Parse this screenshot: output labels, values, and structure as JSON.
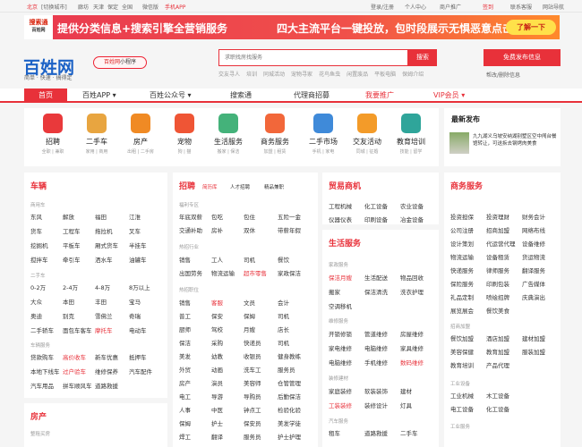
{
  "topbar": {
    "city": "北京",
    "switch": "[切换城市]",
    "links": [
      "廊坊",
      "天津",
      "保定",
      "全国",
      "微信版",
      "手机APP"
    ],
    "right": [
      "登录/注册",
      "个人中心",
      "商户推广",
      "签到",
      "联系客服",
      "网站导航"
    ]
  },
  "banner": {
    "logo_top": "搜索通",
    "logo_bottom": "百姓网",
    "text1": "提供分类信息+搜索引擎全营销服务",
    "text2": "四大主流平台一键投放，包时段展示无惧恶意点击",
    "button": "了解一下"
  },
  "brand": {
    "logo": "百姓网",
    "slogan": "简单 · 快速 · 搞得定",
    "mini_prefix": "百姓网",
    "mini_suffix": "小程序"
  },
  "search": {
    "placeholder": "求职找房找服务",
    "button": "搜索",
    "hot": [
      "交友寻人",
      "培训",
      "同城活动",
      "宠物寻家",
      "花鸟鱼虫",
      "闲置废品",
      "平板电脑",
      "保姆介绍"
    ]
  },
  "publish": {
    "button": "免费发布信息",
    "sub": "帮改/删除信息"
  },
  "nav": [
    "首页",
    "百姓APP ▾",
    "百姓公众号 ▾",
    "搜索通",
    "代理商招募",
    "我要推广",
    "VIP会员 ▾"
  ],
  "categories": [
    {
      "name": "招聘",
      "sub": "全职 | 兼职",
      "color": "#e9393b"
    },
    {
      "name": "二手车",
      "sub": "家用 | 商用",
      "color": "#e8a540"
    },
    {
      "name": "房产",
      "sub": "出租 | 二手房",
      "color": "#f08a24"
    },
    {
      "name": "宠物",
      "sub": "狗 | 猫",
      "color": "#ef5535"
    },
    {
      "name": "生活服务",
      "sub": "搬家 | 保洁",
      "color": "#44b27a"
    },
    {
      "name": "商务服务",
      "sub": "加盟 | 租赁",
      "color": "#f2673a"
    },
    {
      "name": "二手市场",
      "sub": "手机 | 家电",
      "color": "#3f8ad9"
    },
    {
      "name": "交友活动",
      "sub": "同城 | 征婚",
      "color": "#f39b29"
    },
    {
      "name": "教育培训",
      "sub": "技能 | 留学",
      "color": "#2fa59a"
    }
  ],
  "news": {
    "title": "最新发布",
    "item": "九九湖义乌坡安纳湖别墅区空中闯台餐馆转让，可送拆去钢烤肉美食"
  },
  "car": {
    "title": "车辆",
    "sub1": "商用车",
    "rows1": [
      [
        "东风",
        "解放",
        "福田",
        "江淮"
      ],
      [
        "货车",
        "工程车",
        "拖拉机",
        "叉车"
      ],
      [
        "挖掘机",
        "平板车",
        "厢式货车",
        "半挂车"
      ],
      [
        "搅拌车",
        "牵引车",
        "洒水车",
        "油罐车"
      ]
    ],
    "sub2": "二手车",
    "rows2": [
      [
        "0-2万",
        "2-4万",
        "4-8万",
        "8万以上"
      ],
      [
        "大众",
        "本田",
        "丰田",
        "宝马"
      ],
      [
        "奥迪",
        "别克",
        "雪佛兰",
        "奇瑞"
      ],
      [
        "二手轿车",
        "面包车客车",
        "摩托车",
        "电动车"
      ]
    ],
    "sub3": "车辆服务",
    "rows3": [
      [
        "贷款购车",
        "高价收车",
        "新车优惠",
        "抵押车"
      ],
      [
        "本地下线车",
        "过户验车",
        "维修保养",
        "汽车配件"
      ],
      [
        "汽车用品",
        "拼车顺风车",
        "道路救援",
        ""
      ]
    ]
  },
  "house": {
    "title": "房产",
    "sub": "整租买房"
  },
  "job": {
    "title": "招聘",
    "tabs": [
      "简历库",
      "人才招聘",
      "精品兼职"
    ],
    "sub1": "福利专区",
    "rows1": [
      [
        "年底双薪",
        "包吃",
        "包住",
        "五险一金"
      ],
      [
        "交通补助",
        "房补",
        "双休",
        "带薪年假"
      ]
    ],
    "sub2": "热招行业",
    "rows2": [
      [
        "销售",
        "工人",
        "司机",
        "餐饮"
      ],
      [
        "出国劳务",
        "物流运输",
        "超市零售",
        "家政保洁"
      ]
    ],
    "sub3": "热招职位",
    "rows3": [
      [
        "销售",
        "客服",
        "文员",
        "会计"
      ],
      [
        "普工",
        "保安",
        "保姆",
        "司机"
      ],
      [
        "厨师",
        "驾校",
        "月嫂",
        "店长"
      ],
      [
        "保洁",
        "采购",
        "快递员",
        "司机"
      ],
      [
        "美发",
        "幼教",
        "收银员",
        "健身教练"
      ],
      [
        "外贸",
        "动画",
        "洗车工",
        "服务员"
      ],
      [
        "房产",
        "演员",
        "美容师",
        "仓管管理"
      ],
      [
        "电工",
        "导游",
        "导购员",
        "后勤保洁"
      ],
      [
        "人事",
        "中医",
        "钟点工",
        "检验化验"
      ],
      [
        "保姆",
        "护士",
        "保安员",
        "美发学徒"
      ],
      [
        "焊工",
        "翻译",
        "服务员",
        "护士护理"
      ]
    ]
  },
  "trade": {
    "title": "贸易商机",
    "rows": [
      [
        "工程机械",
        "化工设备",
        "农业设备"
      ],
      [
        "仪器仪表",
        "印刷设备",
        "冶金设备"
      ]
    ]
  },
  "life": {
    "title": "生活服务",
    "sub1": "家政服务",
    "rows1": [
      [
        "保洁月嫂",
        "生活配送",
        "物品回收"
      ],
      [
        "搬家",
        "保洁清洗",
        "洗衣护理"
      ],
      [
        "空调移机",
        "",
        ""
      ]
    ],
    "sub2": "维修服务",
    "rows2": [
      [
        "开锁修锁",
        "管道维修",
        "房屋维修"
      ],
      [
        "家电维修",
        "电脑维修",
        "家具维修"
      ],
      [
        "电脑维修",
        "手机维修",
        "数码维修"
      ]
    ],
    "sub3": "装修建材",
    "rows3": [
      [
        "家庭装修",
        "软装装饰",
        "建材"
      ],
      [
        "工装装修",
        "装修设计",
        "灯具"
      ]
    ],
    "sub4": "汽车服务",
    "rows4": [
      [
        "租车",
        "道路救援",
        "二手车"
      ]
    ]
  },
  "biz": {
    "title": "商务服务",
    "rows1": [
      [
        "投资担保",
        "投资理财",
        "财务会计"
      ],
      [
        "公司注册",
        "招商加盟",
        "网络布线"
      ],
      [
        "设计策划",
        "代运营代理",
        "设备维修"
      ],
      [
        "物流运输",
        "设备租赁",
        "货运物流"
      ],
      [
        "快递服务",
        "律师服务",
        "翻译服务"
      ],
      [
        "保险服务",
        "印刷包装",
        "广告媒体"
      ],
      [
        "礼品定制",
        "喷绘招牌",
        "庆典演出"
      ],
      [
        "展览展会",
        "餐饮美食",
        ""
      ]
    ],
    "sub2": "招商加盟",
    "rows2": [
      [
        "餐饮加盟",
        "酒店加盟",
        "建材加盟"
      ],
      [
        "美容保健",
        "教育加盟",
        "服装加盟"
      ],
      [
        "教育培训",
        "产品代理",
        ""
      ]
    ],
    "sub3": "工业设备",
    "rows3": [
      [
        "工业机械",
        "木工设备",
        ""
      ],
      [
        "电工设备",
        "化工设备",
        ""
      ]
    ],
    "sub4": "工业服务"
  }
}
